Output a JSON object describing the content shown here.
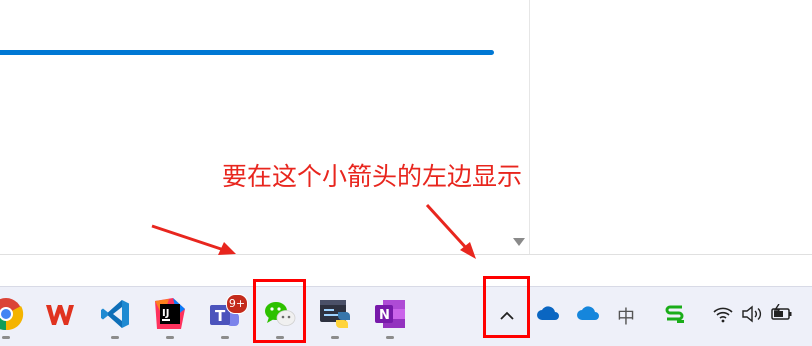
{
  "annotation": {
    "text": "要在这个小箭头的左边显示"
  },
  "taskbar": {
    "apps": [
      {
        "name": "chrome"
      },
      {
        "name": "wps",
        "label": "W"
      },
      {
        "name": "vscode"
      },
      {
        "name": "intellij",
        "label": "IJ"
      },
      {
        "name": "teams",
        "label": "T",
        "badge": "9+"
      },
      {
        "name": "wechat"
      },
      {
        "name": "terminal"
      },
      {
        "name": "onenote",
        "label": "N"
      }
    ],
    "tray": {
      "overflow_chevron": "^",
      "ime_label": "中"
    }
  },
  "colors": {
    "accent": "#0078d4",
    "annotation": "#e8261e",
    "highlight": "#ff0000",
    "taskbar_bg": "#eef0f9"
  }
}
